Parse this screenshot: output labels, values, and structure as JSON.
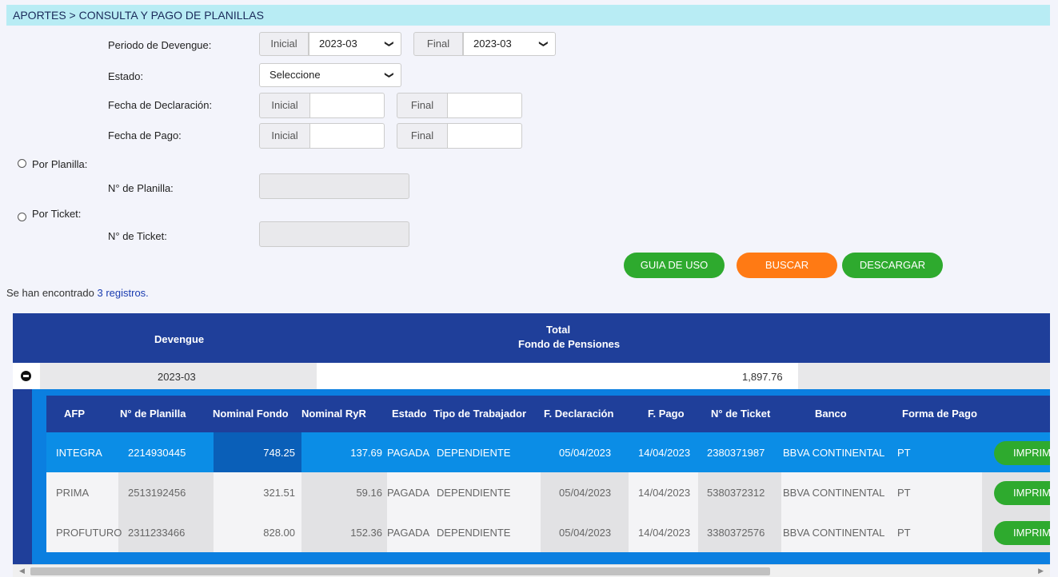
{
  "breadcrumb": "APORTES > CONSULTA Y PAGO DE PLANILLAS",
  "filters": {
    "periodo_label": "Periodo de Devengue:",
    "inicial_label": "Inicial",
    "final_label": "Final",
    "periodo_inicial": "2023-03",
    "periodo_final": "2023-03",
    "estado_label": "Estado:",
    "estado_value": "Seleccione",
    "fecha_decl_label": "Fecha de Declaración:",
    "fecha_pago_label": "Fecha de Pago:",
    "por_planilla_label": "Por Planilla:",
    "nro_planilla_label": "N° de Planilla:",
    "por_ticket_label": "Por Ticket:",
    "nro_ticket_label": "N° de Ticket:"
  },
  "buttons": {
    "guia": "GUIA DE USO",
    "buscar": "BUSCAR",
    "descargar": "DESCARGAR"
  },
  "results": {
    "prefix": "Se han encontrado ",
    "link": "3 registros."
  },
  "main_table": {
    "col_devengue": "Devengue",
    "col_total_line1": "Total",
    "col_total_line2": "Fondo de Pensiones",
    "group_devengue": "2023-03",
    "group_total": "1,897.76"
  },
  "sub_table": {
    "headers": [
      "AFP",
      "N° de Planilla",
      "Nominal Fondo",
      "Nominal RyR",
      "Estado",
      "Tipo de Trabajador",
      "F. Declaración",
      "F. Pago",
      "N° de Ticket",
      "Banco",
      "Forma de Pago"
    ],
    "rows": [
      {
        "afp": "INTEGRA",
        "planilla": "2214930445",
        "nominal_fondo": "748.25",
        "nominal_ryr": "137.69",
        "estado": "PAGADA",
        "tipo": "DEPENDIENTE",
        "f_decl": "05/04/2023",
        "f_pago": "14/04/2023",
        "ticket": "2380371987",
        "banco": "BBVA CONTINENTAL",
        "forma": "PT",
        "action": "IMPRIMIR"
      },
      {
        "afp": "PRIMA",
        "planilla": "2513192456",
        "nominal_fondo": "321.51",
        "nominal_ryr": "59.16",
        "estado": "PAGADA",
        "tipo": "DEPENDIENTE",
        "f_decl": "05/04/2023",
        "f_pago": "14/04/2023",
        "ticket": "5380372312",
        "banco": "BBVA CONTINENTAL",
        "forma": "PT",
        "action": "IMPRIMIR"
      },
      {
        "afp": "PROFUTURO",
        "planilla": "2311233466",
        "nominal_fondo": "828.00",
        "nominal_ryr": "152.36",
        "estado": "PAGADA",
        "tipo": "DEPENDIENTE",
        "f_decl": "05/04/2023",
        "f_pago": "14/04/2023",
        "ticket": "3380372576",
        "banco": "BBVA CONTINENTAL",
        "forma": "PT",
        "action": "IMPRIMIR"
      }
    ]
  },
  "icons": {
    "collapse": "minus-circle-icon",
    "chevron": "chevron-down-icon"
  }
}
